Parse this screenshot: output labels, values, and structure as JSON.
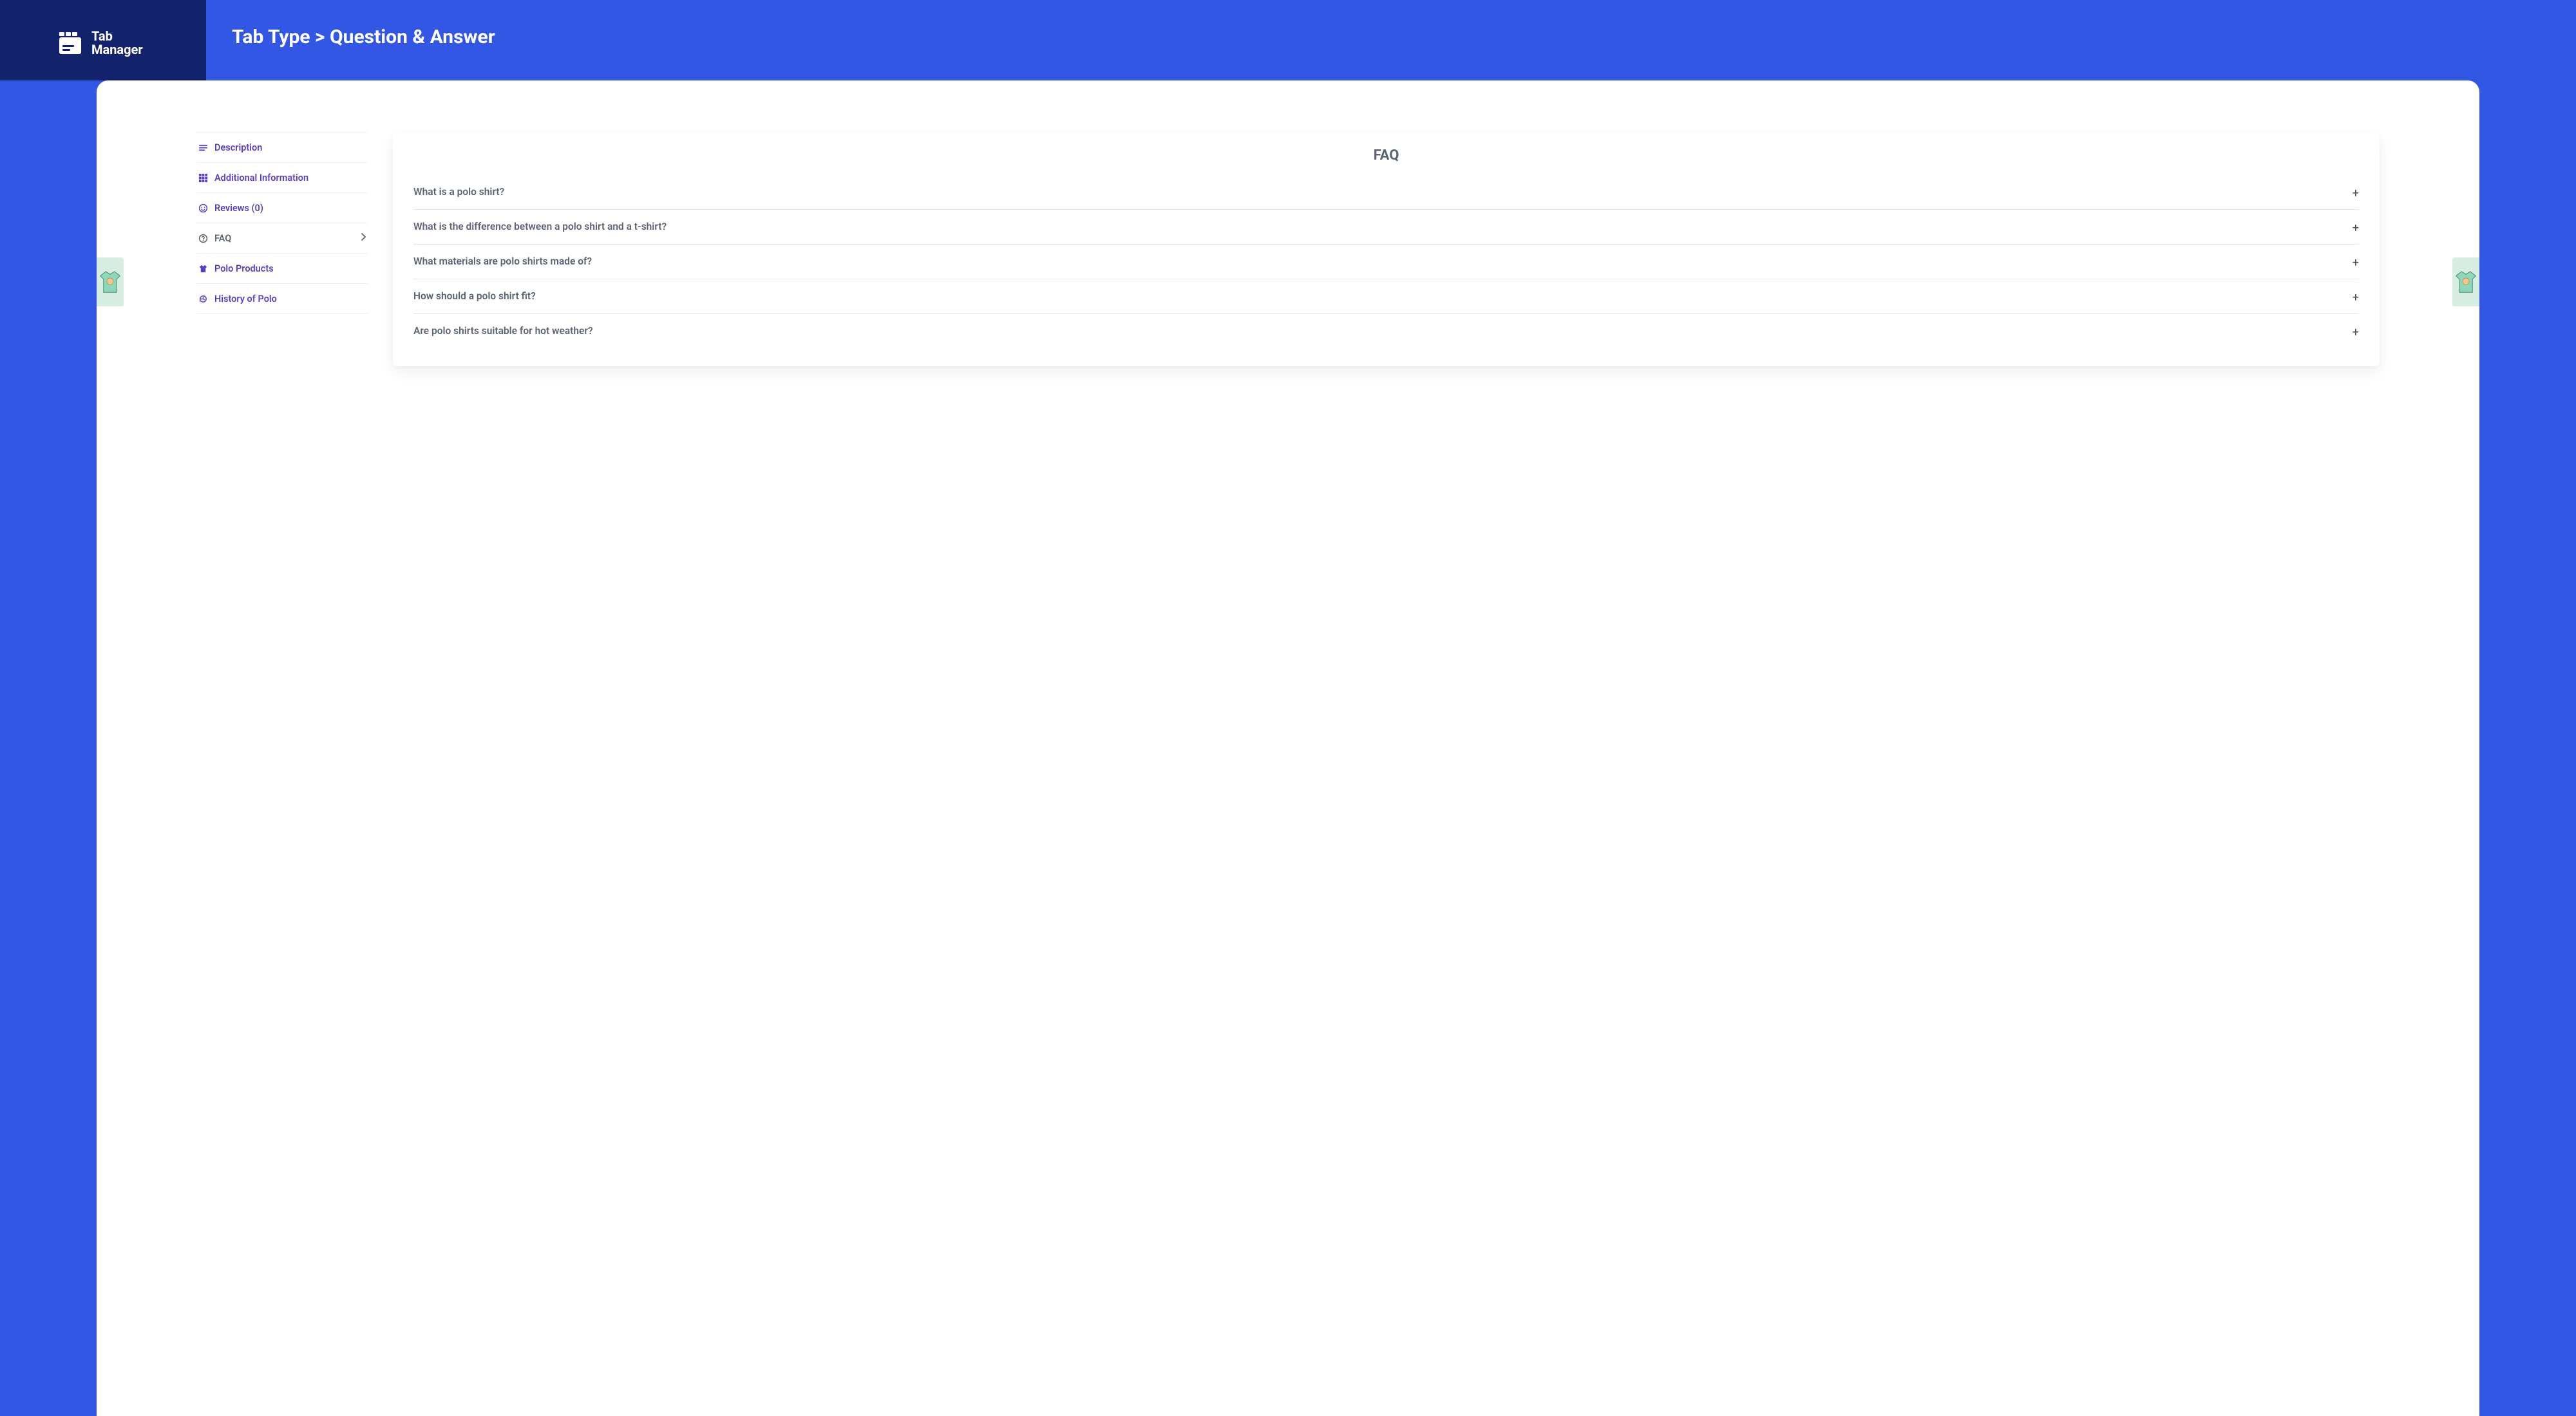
{
  "brand": {
    "name": "Tab\nManager"
  },
  "header": {
    "breadcrumb": "Tab Type > Question & Answer"
  },
  "sidebar": {
    "items": [
      {
        "icon": "lines-icon",
        "label": "Description",
        "active": false
      },
      {
        "icon": "grid-icon",
        "label": "Additional Information",
        "active": false
      },
      {
        "icon": "smile-icon",
        "label": "Reviews (0)",
        "active": false
      },
      {
        "icon": "question-icon",
        "label": "FAQ",
        "active": true
      },
      {
        "icon": "shirt-icon",
        "label": "Polo Products",
        "active": false
      },
      {
        "icon": "history-icon",
        "label": "History of Polo",
        "active": false
      }
    ]
  },
  "faq": {
    "title": "FAQ",
    "items": [
      {
        "q": "What is a polo shirt?"
      },
      {
        "q": "What is the difference between a polo shirt and a t-shirt?"
      },
      {
        "q": "What materials are polo shirts made of?"
      },
      {
        "q": "How should a polo shirt fit?"
      },
      {
        "q": "Are polo shirts suitable for hot weather?"
      }
    ]
  },
  "colors": {
    "brandBlue": "#3357e5",
    "darkBlue": "#12226b",
    "purple": "#5c3fc2",
    "gray": "#5b6470"
  }
}
